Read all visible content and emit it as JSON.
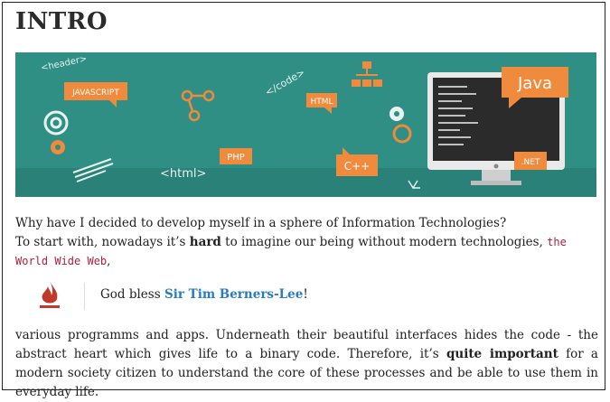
{
  "heading": "INTRO",
  "banner": {
    "labels": {
      "header_tag": "<header>",
      "javascript": "JAVASCRIPT",
      "code_tag": "</code>",
      "html": "HTML",
      "java": "Java",
      "php": "PHP",
      "html_tag": "<html>",
      "cpp": "C++",
      "net": ".NET"
    },
    "colors": {
      "teal": "#2f8f84",
      "orange": "#f08a3c",
      "screen": "#2b2b2b"
    }
  },
  "paragraph1": {
    "line1": "Why have I decided to develop myself in a sphere of Information Technologies?",
    "line2_prefix": "To start with, nowadays it’s ",
    "line2_bold": "hard",
    "line2_suffix": " to imagine our being without modern technologies, ",
    "code": "the World Wide Web",
    "after_code": ","
  },
  "quote": {
    "prefix": "God bless ",
    "name": "Sir Tim Berners-Lee",
    "suffix": "!",
    "icon": "flame-icon",
    "icon_color": "#c0392b"
  },
  "paragraph3": {
    "before_bold": "various programms and apps. Underneath their beautiful interfaces hides the code - the abstract heart which gives life to a binary code. Therefore, it’s ",
    "bold": "quite important",
    "after_bold": " for a modern society citizen to understand the core of these processes and be able to use them in everyday life."
  }
}
